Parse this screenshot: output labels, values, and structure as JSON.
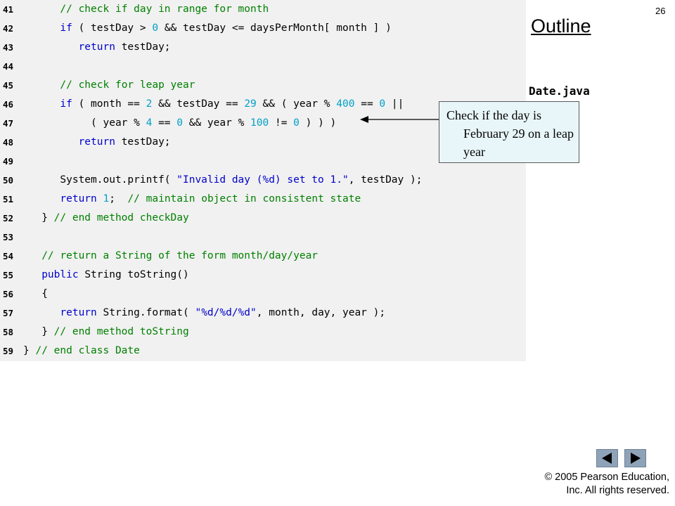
{
  "slide_number": "26",
  "outline_label": "Outline",
  "file_name": "Date.java",
  "callout": {
    "text": "Check if  the day is February 29 on a leap year"
  },
  "code_lines": [
    {
      "n": "41",
      "tokens": [
        [
          "txt",
          "      "
        ],
        [
          "cm",
          "// check if day in range for month"
        ]
      ]
    },
    {
      "n": "42",
      "tokens": [
        [
          "txt",
          "      "
        ],
        [
          "kw",
          "if"
        ],
        [
          "txt",
          " ( testDay > "
        ],
        [
          "num",
          "0"
        ],
        [
          "txt",
          " && testDay <= daysPerMonth[ month ] )"
        ]
      ]
    },
    {
      "n": "43",
      "tokens": [
        [
          "txt",
          "         "
        ],
        [
          "kw",
          "return"
        ],
        [
          "txt",
          " testDay;"
        ]
      ]
    },
    {
      "n": "44",
      "tokens": []
    },
    {
      "n": "45",
      "tokens": [
        [
          "txt",
          "      "
        ],
        [
          "cm",
          "// check for leap year"
        ]
      ]
    },
    {
      "n": "46",
      "tokens": [
        [
          "txt",
          "      "
        ],
        [
          "kw",
          "if"
        ],
        [
          "txt",
          " ( month == "
        ],
        [
          "num",
          "2"
        ],
        [
          "txt",
          " && testDay == "
        ],
        [
          "num",
          "29"
        ],
        [
          "txt",
          " && ( year % "
        ],
        [
          "num",
          "400"
        ],
        [
          "txt",
          " == "
        ],
        [
          "num",
          "0"
        ],
        [
          "txt",
          " ||"
        ]
      ]
    },
    {
      "n": "47",
      "tokens": [
        [
          "txt",
          "           ( year % "
        ],
        [
          "num",
          "4"
        ],
        [
          "txt",
          " == "
        ],
        [
          "num",
          "0"
        ],
        [
          "txt",
          " && year % "
        ],
        [
          "num",
          "100"
        ],
        [
          "txt",
          " != "
        ],
        [
          "num",
          "0"
        ],
        [
          "txt",
          " ) ) )"
        ]
      ]
    },
    {
      "n": "48",
      "tokens": [
        [
          "txt",
          "         "
        ],
        [
          "kw",
          "return"
        ],
        [
          "txt",
          " testDay;"
        ]
      ]
    },
    {
      "n": "49",
      "tokens": []
    },
    {
      "n": "50",
      "tokens": [
        [
          "txt",
          "      System.out.printf( "
        ],
        [
          "str",
          "\"Invalid day (%d) set to 1.\""
        ],
        [
          "txt",
          ", testDay );"
        ]
      ]
    },
    {
      "n": "51",
      "tokens": [
        [
          "txt",
          "      "
        ],
        [
          "kw",
          "return"
        ],
        [
          "txt",
          " "
        ],
        [
          "num",
          "1"
        ],
        [
          "txt",
          ";  "
        ],
        [
          "cm",
          "// maintain object in consistent state"
        ]
      ]
    },
    {
      "n": "52",
      "tokens": [
        [
          "txt",
          "   } "
        ],
        [
          "cm",
          "// end method checkDay"
        ]
      ]
    },
    {
      "n": "53",
      "tokens": []
    },
    {
      "n": "54",
      "tokens": [
        [
          "txt",
          "   "
        ],
        [
          "cm",
          "// return a String of the form month/day/year"
        ]
      ]
    },
    {
      "n": "55",
      "tokens": [
        [
          "txt",
          "   "
        ],
        [
          "kw",
          "public"
        ],
        [
          "txt",
          " String toString()"
        ]
      ]
    },
    {
      "n": "56",
      "tokens": [
        [
          "txt",
          "   {"
        ]
      ]
    },
    {
      "n": "57",
      "tokens": [
        [
          "txt",
          "      "
        ],
        [
          "kw",
          "return"
        ],
        [
          "txt",
          " String.format( "
        ],
        [
          "str",
          "\"%d/%d/%d\""
        ],
        [
          "txt",
          ", month, day, year );"
        ]
      ]
    },
    {
      "n": "58",
      "tokens": [
        [
          "txt",
          "   } "
        ],
        [
          "cm",
          "// end method toString"
        ]
      ]
    },
    {
      "n": "59",
      "tokens": [
        [
          "txt",
          "} "
        ],
        [
          "cm",
          "// end class Date"
        ]
      ]
    }
  ],
  "navigation": {
    "prev_icon": "triangle-left-icon",
    "next_icon": "triangle-right-icon"
  },
  "copyright": {
    "line1": "© 2005 Pearson Education,",
    "line2": "Inc.  All rights reserved."
  },
  "colors": {
    "keyword": "#0000cc",
    "comment": "#008000",
    "number": "#00a0c8",
    "code_bg": "#f1f1f1",
    "callout_bg": "#e9f6f9",
    "nav_button": "#8fa3b8"
  }
}
